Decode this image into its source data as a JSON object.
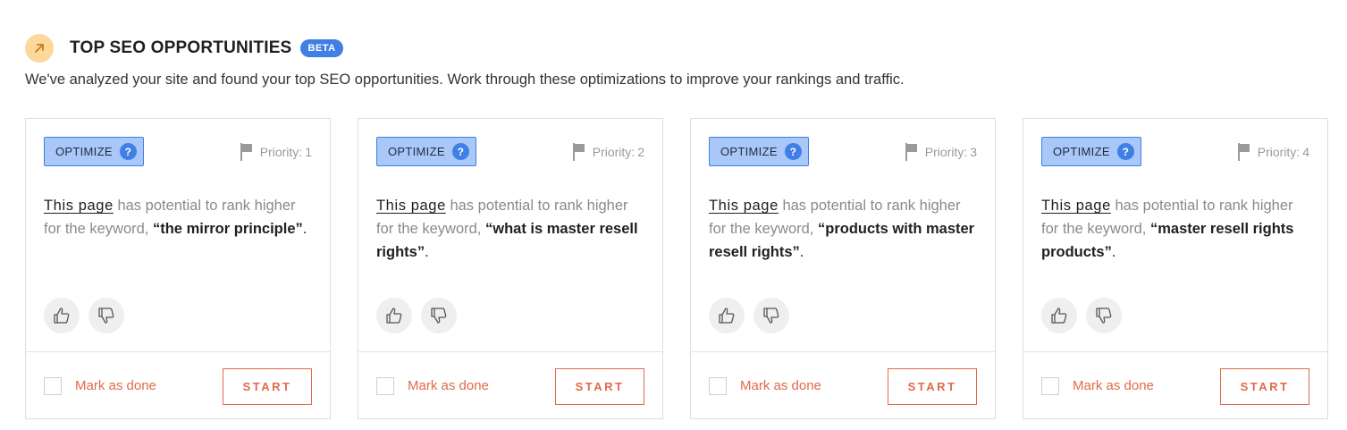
{
  "header": {
    "title": "TOP SEO OPPORTUNITIES",
    "badge": "BETA",
    "icon": "arrow-up-right-icon",
    "subtitle": "We've analyzed your site and found your top SEO opportunities. Work through these optimizations to improve your rankings and traffic."
  },
  "colors": {
    "accent_blue": "#3f7fe6",
    "optimize_bg": "#a9c7f7",
    "header_icon_bg": "#fcd89a",
    "action_orange": "#e06a4a"
  },
  "cards": [
    {
      "tag": "OPTIMIZE",
      "help": "?",
      "priority_label": "Priority:",
      "priority_value": "1",
      "link_text": "This page",
      "desc_mid": " has potential to rank higher for the keyword, ",
      "keyword": "“the mirror principle”",
      "desc_end": ".",
      "mark_done": "Mark as done",
      "start": "START"
    },
    {
      "tag": "OPTIMIZE",
      "help": "?",
      "priority_label": "Priority:",
      "priority_value": "2",
      "link_text": "This page",
      "desc_mid": " has potential to rank higher for the keyword, ",
      "keyword": "“what is master resell rights”",
      "desc_end": ".",
      "mark_done": "Mark as done",
      "start": "START"
    },
    {
      "tag": "OPTIMIZE",
      "help": "?",
      "priority_label": "Priority:",
      "priority_value": "3",
      "link_text": "This page",
      "desc_mid": " has potential to rank higher for the keyword, ",
      "keyword": "“products with master resell rights”",
      "desc_end": ".",
      "mark_done": "Mark as done",
      "start": "START"
    },
    {
      "tag": "OPTIMIZE",
      "help": "?",
      "priority_label": "Priority:",
      "priority_value": "4",
      "link_text": "This page",
      "desc_mid": " has potential to rank higher for the keyword, ",
      "keyword": "“master resell rights products”",
      "desc_end": ".",
      "mark_done": "Mark as done",
      "start": "START"
    }
  ]
}
